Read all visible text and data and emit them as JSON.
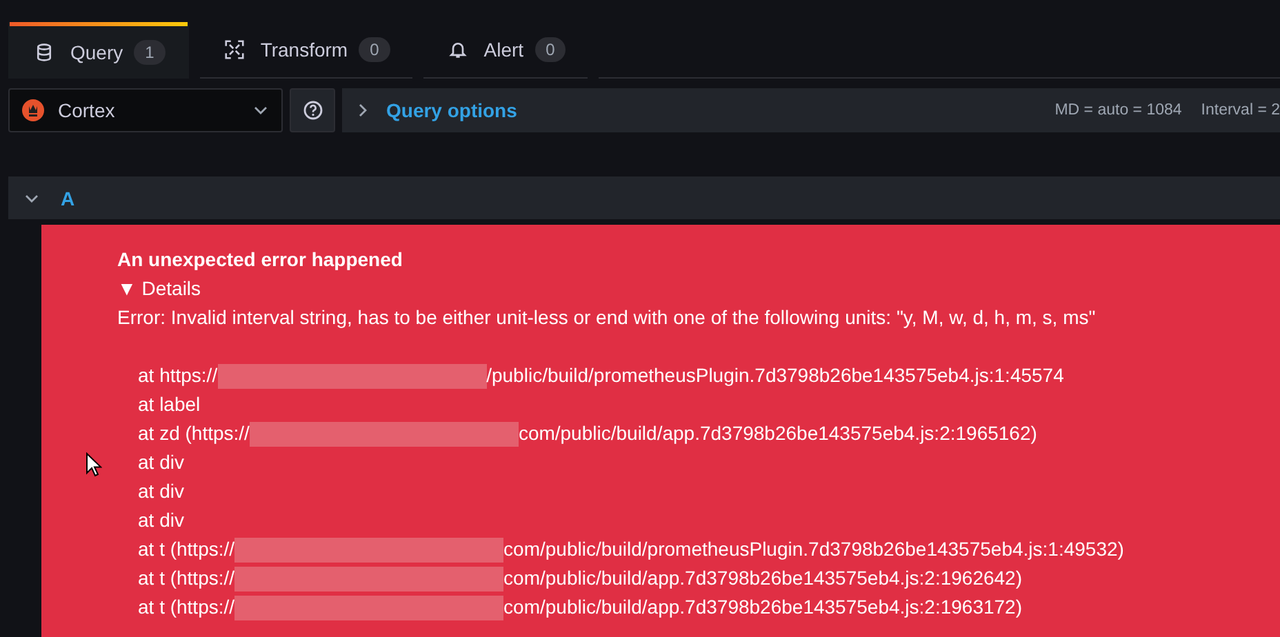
{
  "tabs": [
    {
      "label": "Query",
      "count": "1",
      "selected": true
    },
    {
      "label": "Transform",
      "count": "0",
      "selected": false
    },
    {
      "label": "Alert",
      "count": "0",
      "selected": false
    }
  ],
  "datasource": {
    "name": "Cortex"
  },
  "query_options": {
    "label": "Query options",
    "expanded": false,
    "info": [
      "MD = auto = 1084",
      "Interval = 2"
    ]
  },
  "query_row": {
    "label": "A",
    "expanded": true
  },
  "error": {
    "title": "An unexpected error happened",
    "details_label": "▼ Details",
    "message": "Error: Invalid interval string, has to be either unit-less or end with one of the following units: \"y, M, w, d, h, m, s, ms\"",
    "stack": [
      {
        "before": "at https://",
        "redacted": true,
        "after": "/public/build/prometheusPlugin.7d3798b26be143575eb4.js:1:45574"
      },
      {
        "before": "at label",
        "redacted": false
      },
      {
        "before": "at zd (https://",
        "redacted": true,
        "after": "com/public/build/app.7d3798b26be143575eb4.js:2:1965162)"
      },
      {
        "before": "at div",
        "redacted": false
      },
      {
        "before": "at div",
        "redacted": false
      },
      {
        "before": "at div",
        "redacted": false
      },
      {
        "before": "at t (https://",
        "redacted": true,
        "after": "com/public/build/prometheusPlugin.7d3798b26be143575eb4.js:1:49532)"
      },
      {
        "before": "at t (https://",
        "redacted": true,
        "after": "com/public/build/app.7d3798b26be143575eb4.js:2:1962642)"
      },
      {
        "before": "at t (https://",
        "redacted": true,
        "after": "com/public/build/app.7d3798b26be143575eb4.js:2:1963172)"
      }
    ]
  }
}
